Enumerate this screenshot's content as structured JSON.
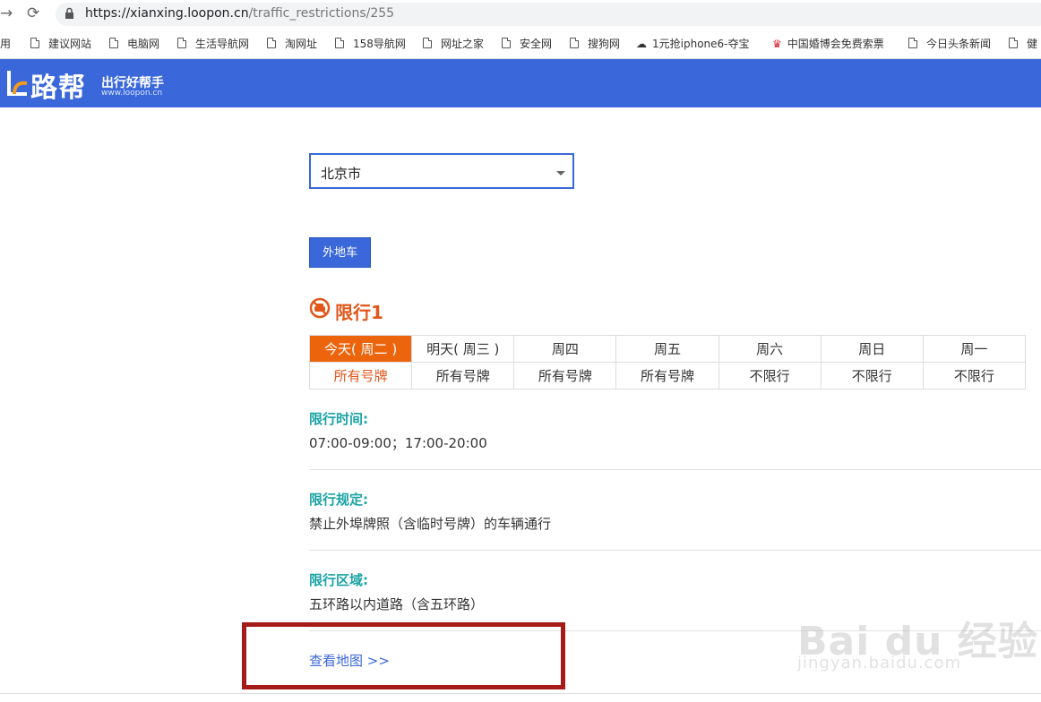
{
  "browser": {
    "url_host": "https://xianxing.loopon.cn",
    "url_path": "/traffic_restrictions/255",
    "bookmarks": [
      "应用",
      "建议网站",
      "电脑网",
      "生活导航网",
      "淘网址",
      "158导航网",
      "网址之家",
      "安全网",
      "搜狗网",
      "1元抢iphone6-夺宝",
      "中国婚博会免费索票",
      "今日头条新闻",
      "健"
    ]
  },
  "header": {
    "logo_text": "路帮",
    "slogan": "出行好帮手",
    "slogan_sub": "www.loopon.cn"
  },
  "city": {
    "selected": "北京市"
  },
  "out_btn_label": "外地车",
  "section_title": "限行1",
  "days": [
    {
      "day": "今天( 周二 )",
      "value": "所有号牌"
    },
    {
      "day": "明天( 周三 )",
      "value": "所有号牌"
    },
    {
      "day": "周四",
      "value": "所有号牌"
    },
    {
      "day": "周五",
      "value": "所有号牌"
    },
    {
      "day": "周六",
      "value": "不限行"
    },
    {
      "day": "周日",
      "value": "不限行"
    },
    {
      "day": "周一",
      "value": "不限行"
    }
  ],
  "time": {
    "label": "限行时间:",
    "value": "07:00-09:00；17:00-20:00"
  },
  "rule": {
    "label": "限行规定:",
    "value": "禁止外埠牌照（含临时号牌）的车辆通行"
  },
  "area": {
    "label": "限行区域:",
    "value": "五环路以内道路（含五环路）"
  },
  "map_link": "查看地图 >>",
  "watermark": {
    "main": "Bai du 经验",
    "sub": "jingyan.baidu.com"
  }
}
